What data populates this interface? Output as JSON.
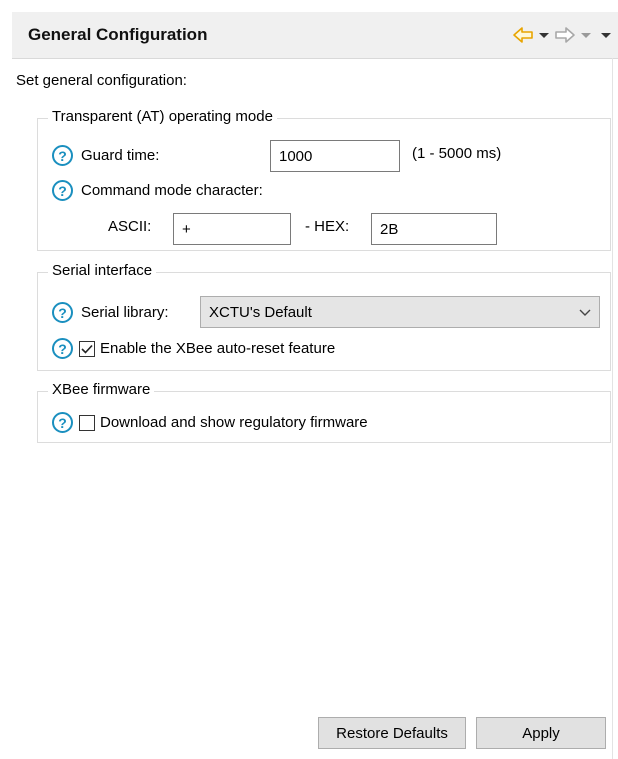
{
  "header": {
    "title": "General Configuration"
  },
  "intro": "Set general configuration:",
  "transparent": {
    "legend": "Transparent (AT) operating mode",
    "guard_label": "Guard time:",
    "guard_value": "1000",
    "guard_range": "(1 - 5000 ms)",
    "cmd_label": "Command mode character:",
    "ascii_label": "ASCII:",
    "ascii_value": "+",
    "hex_label": "- HEX:",
    "hex_value": "2B"
  },
  "serial": {
    "legend": "Serial interface",
    "library_label": "Serial library:",
    "library_value": "XCTU's Default",
    "autoreset_label": "Enable the XBee auto-reset feature",
    "autoreset_checked": true
  },
  "firmware": {
    "legend": "XBee firmware",
    "regulatory_label": "Download and show regulatory firmware",
    "regulatory_checked": false
  },
  "buttons": {
    "restore": "Restore Defaults",
    "apply": "Apply"
  },
  "colors": {
    "help": "#1a8fbf",
    "nav_back": "#e8a400"
  }
}
